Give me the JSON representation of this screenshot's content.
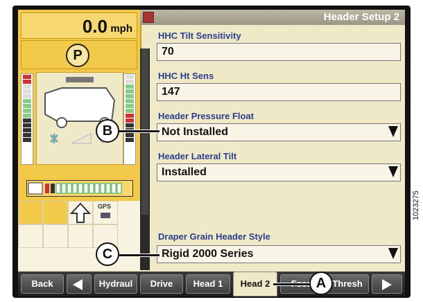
{
  "status": {
    "speed_value": "0.0",
    "speed_unit": "mph",
    "park_indicator": "P"
  },
  "header": {
    "title": "Header Setup 2"
  },
  "fields": [
    {
      "label": "HHC Tilt Sensitivity",
      "value": "70"
    },
    {
      "label": "HHC Ht Sens",
      "value": "147"
    },
    {
      "label": "Header Pressure Float",
      "value": "Not Installed"
    },
    {
      "label": "Header Lateral Tilt",
      "value": "Installed"
    },
    {
      "label": "Draper Grain Header Style",
      "value": "Rigid 2000 Series"
    }
  ],
  "gps_label": "GPS",
  "nav": {
    "back": "Back",
    "tabs": [
      "Hydraul",
      "Drive",
      "Head 1",
      "Head 2",
      "Feed",
      "Thresh"
    ],
    "active_tab": "Head 2"
  },
  "callouts": {
    "a": "A",
    "b": "B",
    "c": "C"
  },
  "figure_number": "1023275",
  "colors": {
    "label_text": "#2b3f8c",
    "panel": "#efe9c8",
    "status_panel": "#f3c94a"
  }
}
